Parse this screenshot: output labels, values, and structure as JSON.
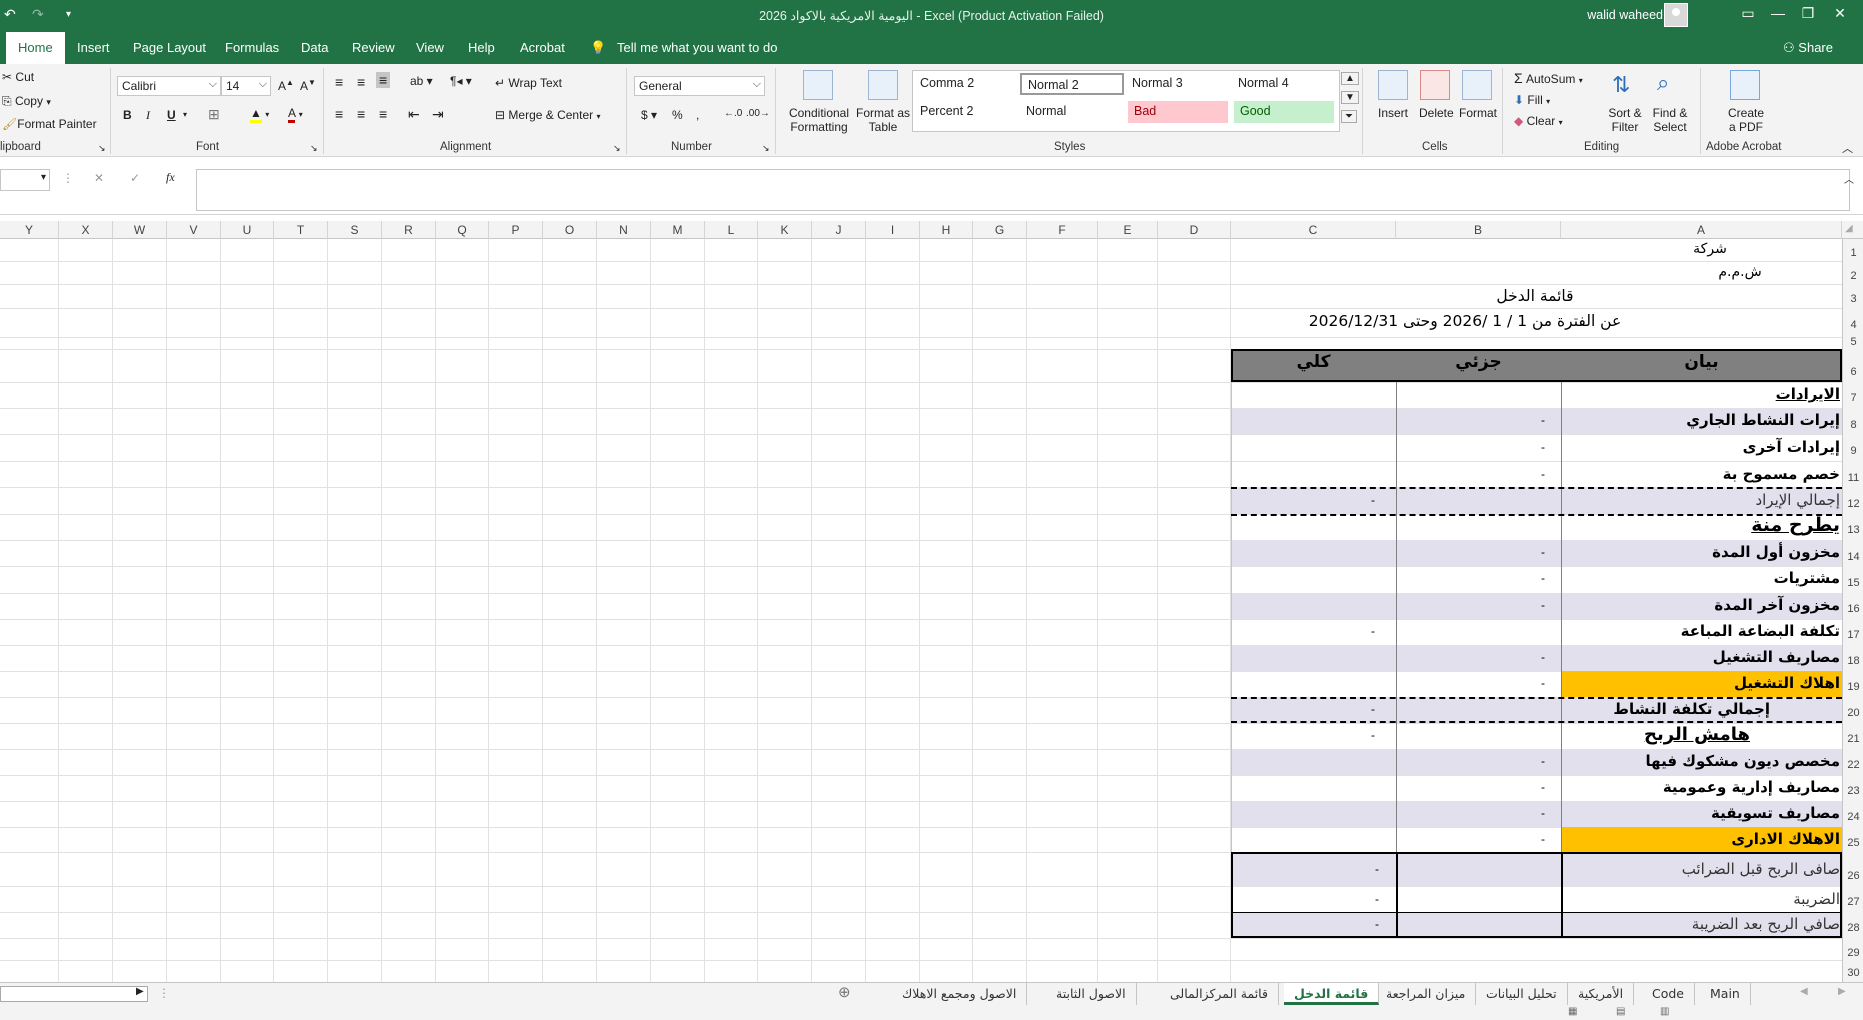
{
  "window": {
    "title": "اليومية الامريكية بالاكواد 2026  -  Excel (Product Activation Failed)",
    "user": "walid waheed",
    "share": "Share"
  },
  "ribbon_tabs": [
    "Home",
    "Insert",
    "Page Layout",
    "Formulas",
    "Data",
    "Review",
    "View",
    "Help",
    "Acrobat"
  ],
  "tell_me": "Tell me what you want to do",
  "clipboard": {
    "cut": "Cut",
    "copy": "Copy",
    "format_painter": "Format Painter",
    "label": "lipboard"
  },
  "font": {
    "name": "Calibri",
    "size": "14",
    "bold": "B",
    "italic": "I",
    "underline": "U",
    "label": "Font"
  },
  "alignment": {
    "wrap_text": "Wrap Text",
    "merge_center": "Merge & Center",
    "label": "Alignment"
  },
  "number": {
    "format": "General",
    "label": "Number"
  },
  "styles": {
    "conditional": "Conditional Formatting",
    "format_as_table": "Format as Table",
    "cells": [
      "Comma 2",
      "Normal 2",
      "Normal 3",
      "Normal 4",
      "Percent 2",
      "Normal",
      "Bad",
      "Good"
    ],
    "label": "Styles"
  },
  "cells_group": {
    "insert": "Insert",
    "delete": "Delete",
    "format": "Format",
    "label": "Cells"
  },
  "editing": {
    "autosum": "AutoSum",
    "fill": "Fill",
    "clear": "Clear",
    "sort_filter": "Sort & Filter",
    "find_select": "Find & Select",
    "label": "Editing"
  },
  "acrobat": {
    "create_pdf": "Create a PDF",
    "label": "Adobe Acrobat"
  },
  "formula_bar": {
    "fx": "fx"
  },
  "columns": [
    "Y",
    "X",
    "W",
    "V",
    "U",
    "T",
    "S",
    "R",
    "Q",
    "P",
    "O",
    "N",
    "M",
    "L",
    "K",
    "J",
    "I",
    "H",
    "G",
    "F",
    "E",
    "D",
    "C",
    "B",
    "A"
  ],
  "rows": [
    "1",
    "2",
    "3",
    "4",
    "5",
    "6",
    "7",
    "8",
    "9",
    "11",
    "12",
    "13",
    "14",
    "15",
    "16",
    "17",
    "18",
    "19",
    "20",
    "21",
    "22",
    "23",
    "24",
    "25",
    "26",
    "27",
    "28",
    "29",
    "30"
  ],
  "sheet": {
    "company": "شركة",
    "company_type": "ش.م.م",
    "report_title": "قائمة الدخل",
    "period": "عن الفترة من 1 / 1 /2026 وحتى 2026/12/31",
    "headers": {
      "statement": "بيان",
      "partial": "جزئي",
      "total": "كلي"
    },
    "lines": [
      {
        "label": "الايرادات",
        "partial": "",
        "total": ""
      },
      {
        "label": "إيرات النشاط الجاري",
        "partial": "-",
        "total": ""
      },
      {
        "label": "إيرادات آخرى",
        "partial": "-",
        "total": ""
      },
      {
        "label": "خصم مسموح بة",
        "partial": "-",
        "total": ""
      },
      {
        "label": "إجمالي الإيراد",
        "partial": "",
        "total": "-"
      },
      {
        "label": "يطرح منة",
        "partial": "",
        "total": ""
      },
      {
        "label": "مخزون أول المدة",
        "partial": "-",
        "total": ""
      },
      {
        "label": "مشتريات",
        "partial": "-",
        "total": ""
      },
      {
        "label": "مخزون آخر المدة",
        "partial": "-",
        "total": ""
      },
      {
        "label": "تكلفة البضاعة المباعة",
        "partial": "",
        "total": "-"
      },
      {
        "label": "مصاريف التشغيل",
        "partial": "-",
        "total": ""
      },
      {
        "label": "اهلاك التشغيل",
        "partial": "-",
        "total": ""
      },
      {
        "label": "إجمالي تكلفة النشاط",
        "partial": "",
        "total": "-"
      },
      {
        "label": "هامش الربح",
        "partial": "",
        "total": "-"
      },
      {
        "label": "مخصص ديون مشكوك فيها",
        "partial": "-",
        "total": ""
      },
      {
        "label": "مصاريف إدارية وعمومية",
        "partial": "-",
        "total": ""
      },
      {
        "label": "مصاريف تسويقية",
        "partial": "-",
        "total": ""
      },
      {
        "label": "الاهلاك الادارى",
        "partial": "-",
        "total": ""
      },
      {
        "label": "صافى الربح قبل الضرائب",
        "partial": "",
        "total": "-"
      },
      {
        "label": "الضريبة",
        "partial": "",
        "total": "-"
      },
      {
        "label": "صافي الربح بعد الضريبة",
        "partial": "",
        "total": "-"
      }
    ]
  },
  "sheet_tabs": [
    "الاصول ومجمع الاهلاك",
    "الاصول الثابتة",
    "قائمة المركزالمالى",
    "قائمة الدخل",
    "ميزان المراجعة",
    "تحليل البيانات",
    "الأمريكية",
    "Code",
    "Main"
  ],
  "active_sheet": "قائمة الدخل",
  "colors": {
    "excel_green": "#217346",
    "band": "#e1e0ec",
    "header_gray": "#808080",
    "orange": "#ffc000",
    "bad_bg": "#ffc7ce",
    "good_bg": "#c6efce"
  }
}
